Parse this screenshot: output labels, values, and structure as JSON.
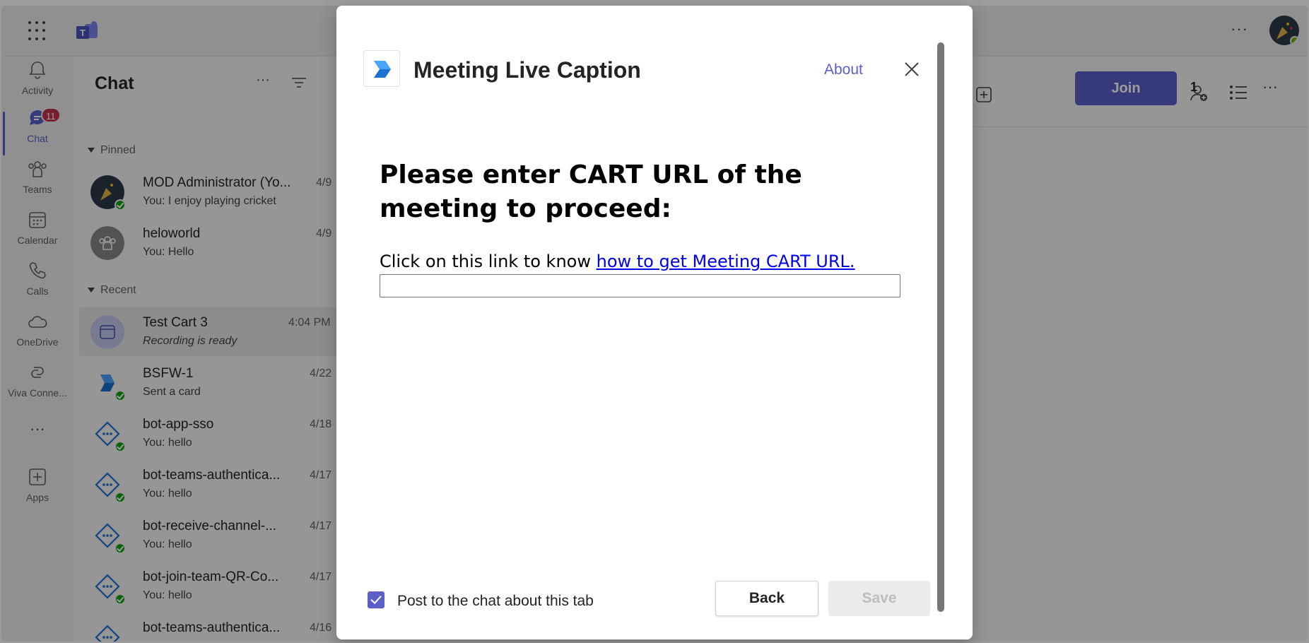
{
  "colors": {
    "brand": "#5b5fc7",
    "presence": "#13a10e",
    "badge": "#c4314b",
    "link": "#0000ee"
  },
  "rail": {
    "items": [
      {
        "label": "Activity",
        "icon": "bell-icon"
      },
      {
        "label": "Chat",
        "icon": "chat-icon",
        "badge": "11"
      },
      {
        "label": "Teams",
        "icon": "teams-icon"
      },
      {
        "label": "Calendar",
        "icon": "calendar-icon"
      },
      {
        "label": "Calls",
        "icon": "phone-icon"
      },
      {
        "label": "OneDrive",
        "icon": "cloud-icon"
      },
      {
        "label": "Viva Conne...",
        "icon": "viva-icon"
      },
      {
        "label": "Apps",
        "icon": "add-app-icon"
      }
    ]
  },
  "chatlist": {
    "title": "Chat",
    "pinned_label": "Pinned",
    "recent_label": "Recent",
    "pinned": [
      {
        "name": "MOD Administrator (Yo...",
        "preview": "You: I enjoy playing cricket",
        "time": "4/9"
      },
      {
        "name": "heloworld",
        "preview": "You: Hello",
        "time": "4/9"
      }
    ],
    "recent": [
      {
        "name": "Test Cart 3",
        "preview": "Recording is ready",
        "time": "4:04 PM"
      },
      {
        "name": "BSFW-1",
        "preview": "Sent a card",
        "time": "4/22"
      },
      {
        "name": "bot-app-sso",
        "preview": "You: hello",
        "time": "4/18"
      },
      {
        "name": "bot-teams-authentica...",
        "preview": "You: hello",
        "time": "4/17"
      },
      {
        "name": "bot-receive-channel-...",
        "preview": "You: hello",
        "time": "4/17"
      },
      {
        "name": "bot-join-team-QR-Co...",
        "preview": "You: hello",
        "time": "4/17"
      },
      {
        "name": "bot-teams-authentica...",
        "preview": "",
        "time": "4/16"
      }
    ]
  },
  "meeting": {
    "join_label": "Join",
    "participant_count": "1"
  },
  "dialog": {
    "title": "Meeting Live Caption",
    "about_label": "About",
    "prompt": "Please enter CART URL of the meeting to proceed:",
    "helper_text": "Click on this link to know ",
    "helper_link": "how to get Meeting CART URL.",
    "url_value": "",
    "post_to_chat_label": "Post to the chat about this tab",
    "post_to_chat_checked": true,
    "back_label": "Back",
    "save_label": "Save"
  }
}
